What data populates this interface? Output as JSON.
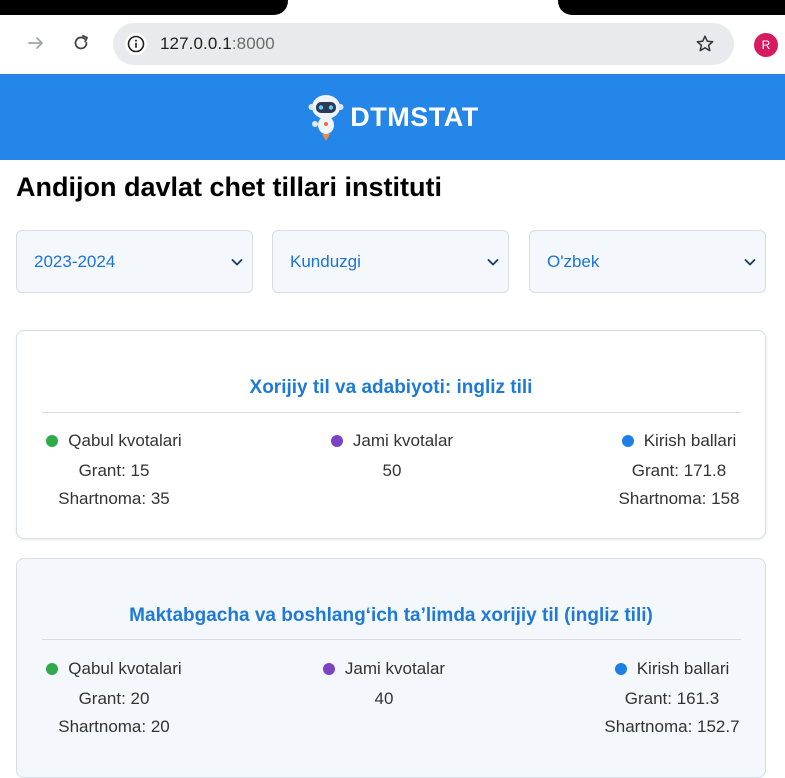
{
  "browser": {
    "url_host": "127.0.0.1",
    "url_port": ":8000",
    "avatar_initial": "R"
  },
  "site": {
    "logo_text": "DTMSTAT",
    "brand_color": "#2486e8"
  },
  "page": {
    "title": "Andijon davlat chet tillari instituti"
  },
  "filters": {
    "year": "2023-2024",
    "study_form": "Kunduzgi",
    "language": "O'zbek"
  },
  "programs": [
    {
      "name": "Xorijiy til va adabiyoti: ingliz tili",
      "quota_label": "Qabul kvotalari",
      "quota_grant": "Grant: 15",
      "quota_contract": "Shartnoma: 35",
      "total_label": "Jami kvotalar",
      "total_value": "50",
      "score_label": "Kirish ballari",
      "score_grant": "Grant: 171.8",
      "score_contract": "Shartnoma: 158"
    },
    {
      "name": "Maktabgacha va boshlang‘ich ta’limda xorijiy til (ingliz tili)",
      "quota_label": "Qabul kvotalari",
      "quota_grant": "Grant: 20",
      "quota_contract": "Shartnoma: 20",
      "total_label": "Jami kvotalar",
      "total_value": "40",
      "score_label": "Kirish ballari",
      "score_grant": "Grant: 161.3",
      "score_contract": "Shartnoma: 152.7"
    }
  ],
  "icons": {
    "forward": "arrow-right-icon",
    "reload": "reload-icon",
    "info": "info-icon",
    "bookmark": "star-icon"
  }
}
